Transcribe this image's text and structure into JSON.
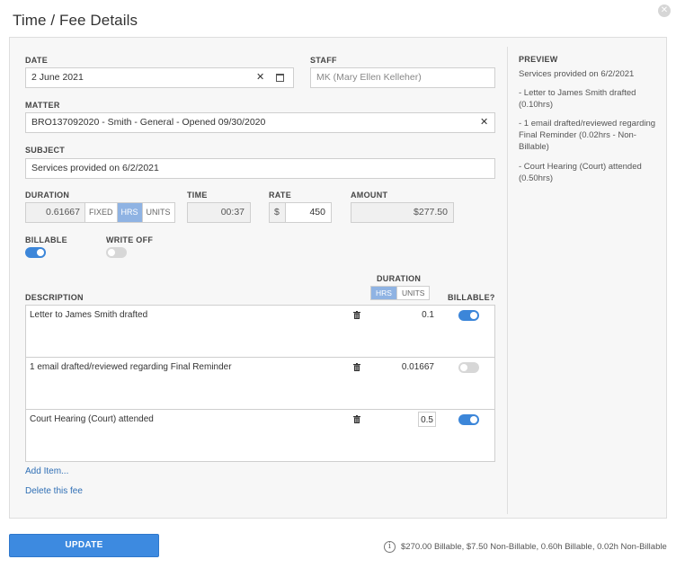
{
  "dialog": {
    "title": "Time / Fee Details",
    "close_icon": "close-icon"
  },
  "form": {
    "date": {
      "label": "DATE",
      "value": "2 June 2021"
    },
    "staff": {
      "label": "STAFF",
      "placeholder": "MK (Mary Ellen Kelleher)"
    },
    "matter": {
      "label": "MATTER",
      "value": "BRO137092020 - Smith - General - Opened 09/30/2020"
    },
    "subject": {
      "label": "SUBJECT",
      "value": "Services provided on 6/2/2021"
    },
    "duration": {
      "label": "DURATION",
      "value": "0.61667",
      "options": [
        "FIXED",
        "HRS",
        "UNITS"
      ],
      "selected": "HRS"
    },
    "time": {
      "label": "TIME",
      "value": "00:37"
    },
    "rate": {
      "label": "RATE",
      "prefix": "$",
      "value": "450"
    },
    "amount": {
      "label": "AMOUNT",
      "value": "$277.50"
    },
    "billable": {
      "label": "BILLABLE",
      "on": true
    },
    "write_off": {
      "label": "WRITE OFF",
      "on": false
    }
  },
  "description": {
    "label": "DESCRIPTION",
    "duration_label": "DURATION",
    "duration_options": [
      "HRS",
      "UNITS"
    ],
    "duration_selected": "HRS",
    "billable_label": "BILLABLE?",
    "items": [
      {
        "text": "Letter to James Smith drafted",
        "duration": "0.1",
        "billable": true
      },
      {
        "text": "1 email drafted/reviewed regarding Final Reminder",
        "duration": "0.01667",
        "billable": false
      },
      {
        "text": "Court Hearing (Court) attended",
        "duration": "0.5",
        "billable": true
      }
    ],
    "add_item": "Add Item...",
    "delete_fee": "Delete this fee"
  },
  "preview": {
    "title": "PREVIEW",
    "heading": "Services provided on 6/2/2021",
    "lines": [
      "- Letter to James Smith drafted (0.10hrs)",
      "- 1 email drafted/reviewed regarding Final Reminder (0.02hrs - Non-Billable)",
      "- Court Hearing (Court) attended (0.50hrs)"
    ]
  },
  "footer": {
    "update_label": "UPDATE",
    "summary": "$270.00 Billable, $7.50 Non-Billable, 0.60h Billable, 0.02h Non-Billable"
  },
  "colors": {
    "accent": "#3d8ae0",
    "toggle_on": "#3c86d9",
    "toggle_off": "#d7d7d7"
  }
}
